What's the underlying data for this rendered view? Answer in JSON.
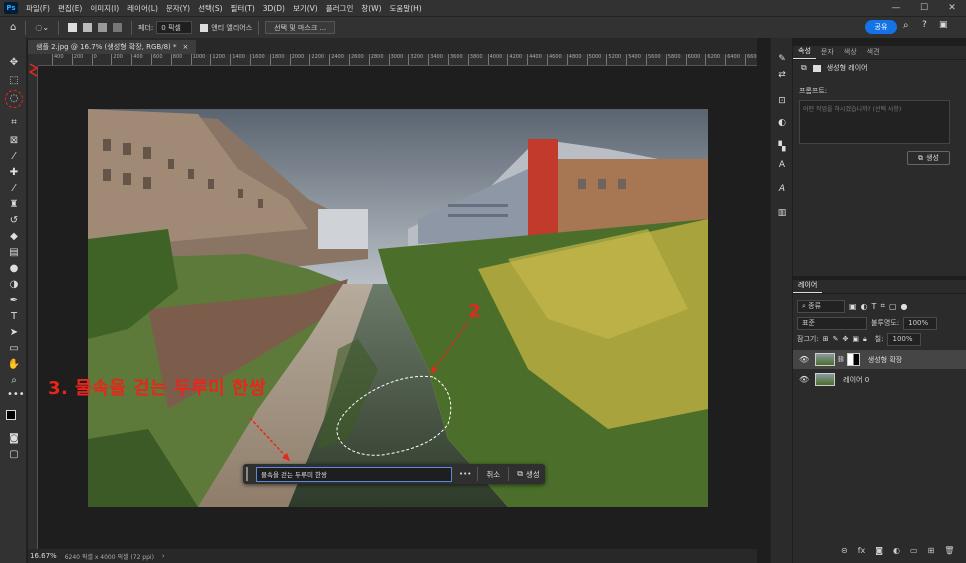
{
  "app": {
    "logo": "Ps",
    "menus": [
      "파일(F)",
      "편집(E)",
      "이미지(I)",
      "레이어(L)",
      "문자(Y)",
      "선택(S)",
      "필터(T)",
      "3D(D)",
      "보기(V)",
      "플러그인",
      "창(W)",
      "도움말(H)"
    ],
    "window_controls": [
      "—",
      "☐",
      "✕"
    ]
  },
  "options_bar": {
    "feather_label": "페더:",
    "feather_value": "0 픽셀",
    "antialias_label": "앤티 앨리어스",
    "select_mask_button": "선택 및 마스크 ...",
    "share_button": "공유"
  },
  "document": {
    "tab_title": "샘플 2.jpg @ 16.7% (생성형 확장, RGB/8) *",
    "zoom": "16.67%",
    "size_info": "6240 픽셀 x 4000 픽셀 (72 ppi)",
    "ruler_ticks": [
      "400",
      "200",
      "0",
      "200",
      "400",
      "600",
      "800",
      "1000",
      "1200",
      "1400",
      "1600",
      "1800",
      "2000",
      "2200",
      "2400",
      "2600",
      "2800",
      "3000",
      "3200",
      "3400",
      "3600",
      "3800",
      "4000",
      "4200",
      "4400",
      "4600",
      "4800",
      "5000",
      "5200",
      "5400",
      "5600",
      "5800",
      "6000",
      "6200",
      "6400",
      "6600"
    ]
  },
  "annotations": {
    "label_3": "3. 물속을 걷는 두루미 한쌍",
    "label_2": "2"
  },
  "contextual_taskbar": {
    "prompt_value": "물속을 걷는 두루미 한쌍",
    "more_label": "•••",
    "cancel_label": "취소",
    "generate_label": "생성"
  },
  "properties_panel": {
    "tabs": [
      "속성",
      "문자",
      "색상",
      "색견"
    ],
    "layer_type": "생성형 레이어",
    "prompt_label": "프롬프트:",
    "prompt_placeholder": "어떤 작업을 하시겠습니까? (선택 사항)",
    "generate_button": "생성"
  },
  "layers_panel": {
    "title": "레이어",
    "filter_label": "종류",
    "blend_mode": "표준",
    "opacity_label": "불투명도:",
    "opacity_value": "100%",
    "lock_label": "잠그기:",
    "fill_label": "칠:",
    "fill_value": "100%",
    "layers": [
      {
        "name": "생성형 확장",
        "selected": true
      },
      {
        "name": "레이어 0",
        "selected": false
      }
    ]
  },
  "colors": {
    "accent": "#1473e6",
    "annotation_red": "#e8261c",
    "bg": "#1e1e1e",
    "panel": "#2b2b2b"
  }
}
